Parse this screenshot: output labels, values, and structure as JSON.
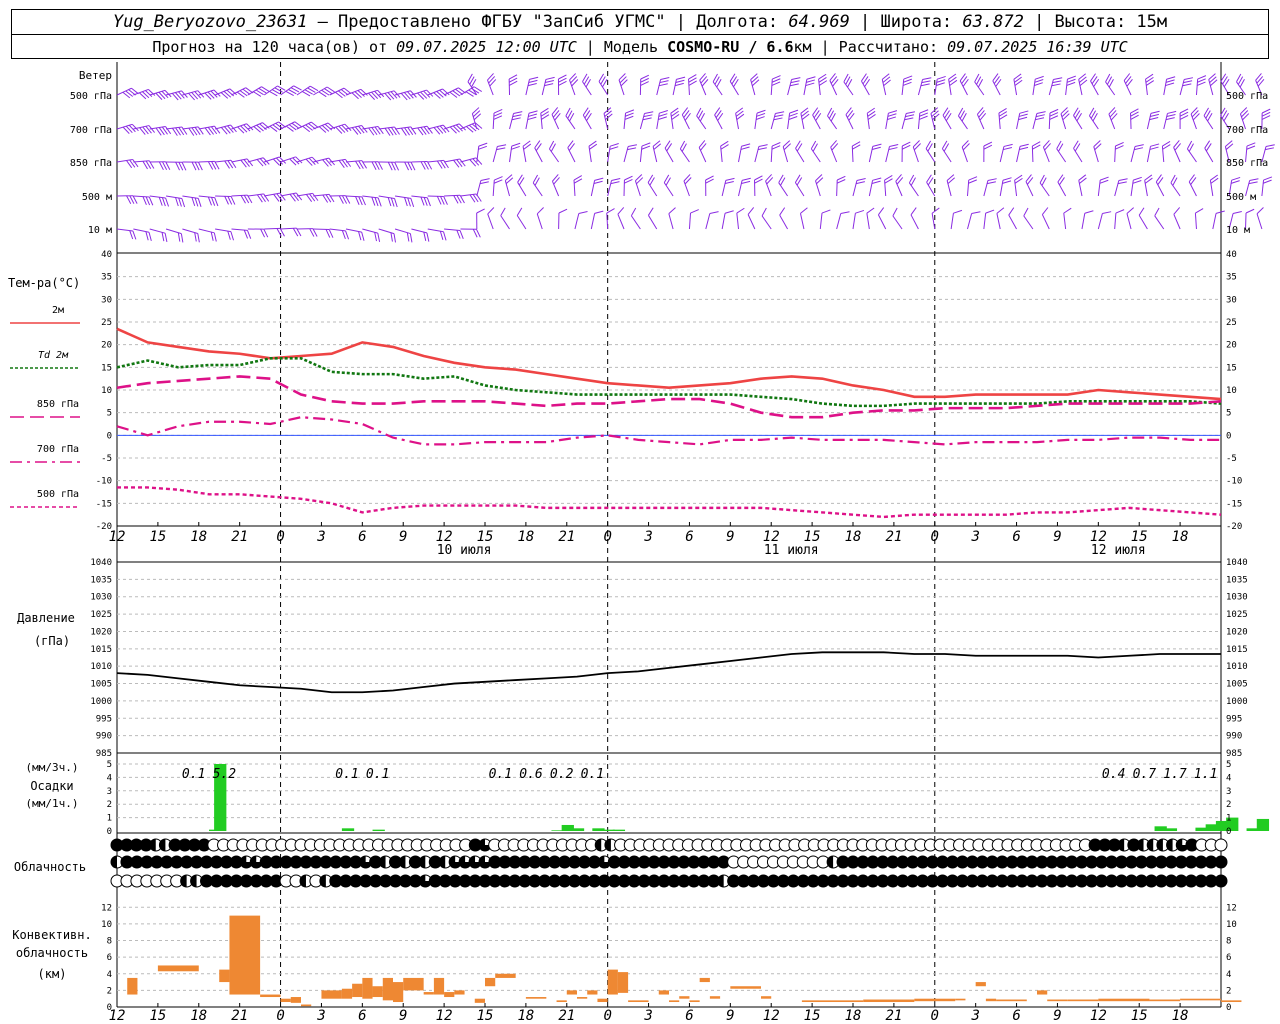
{
  "header": {
    "station": "Yug_Beryozovo_23631",
    "provider": " — Предоставлено ФГБУ \"ЗапСиб УГМС\" | ",
    "lon_label": "Долгота: ",
    "lon_value": "64.969",
    "lat_label": " | Широта: ",
    "lat_value": "63.872",
    "alt_label": " | Высота: ",
    "alt_value": "15м",
    "fc_label": "Прогноз на 120 часа(ов) от ",
    "fc_value": "09.07.2025 12:00 UTC",
    "model_label": " | Модель ",
    "model_value": "COSMO-RU / 6.6",
    "model_unit": "км",
    "calc_label": " | Рассчитано: ",
    "calc_value": "09.07.2025 16:39 UTC"
  },
  "chart_data": {
    "time": {
      "ticks": [
        "12",
        "15",
        "18",
        "21",
        "0",
        "3",
        "6",
        "9",
        "12",
        "15",
        "18",
        "21",
        "0",
        "3",
        "6",
        "9",
        "12",
        "15",
        "18",
        "21",
        "0",
        "3",
        "6",
        "9",
        "12",
        "15",
        "18"
      ],
      "days": [
        {
          "label": "10 июля",
          "at_tick": 8
        },
        {
          "label": "11 июля",
          "at_tick": 16
        },
        {
          "label": "12 июля",
          "at_tick": 24
        }
      ],
      "midnight_ticks": [
        4,
        12,
        20
      ]
    },
    "wind": {
      "title": "Ветер",
      "levels": [
        "500 гПа",
        "700 гПа",
        "850 гПа",
        "500 м",
        "10  м"
      ],
      "color": "#8a2be2"
    },
    "temperature": {
      "title": "Тем-ра(°C)",
      "ylim": [
        -20,
        40
      ],
      "ticks": [
        -20,
        -15,
        -10,
        -5,
        0,
        5,
        10,
        15,
        20,
        25,
        30,
        35,
        40
      ],
      "series": [
        {
          "name": "2м",
          "key": "t2m",
          "color": "#ee4444",
          "values": [
            23.5,
            20.5,
            19.5,
            18.5,
            18,
            17,
            17.5,
            18,
            20.5,
            19.5,
            17.5,
            16,
            15,
            14.5,
            13.5,
            12.5,
            11.5,
            11,
            10.5,
            11,
            11.5,
            12.5,
            13,
            12.5,
            11,
            10,
            8.5,
            8.5,
            9,
            9,
            9,
            9,
            10,
            9.5,
            9,
            8.5,
            8
          ]
        },
        {
          "name": "Td  2м",
          "key": "td2m",
          "color": "#117711",
          "values": [
            15,
            16.5,
            15,
            15.5,
            15.5,
            17,
            17,
            14,
            13.5,
            13.5,
            12.5,
            13,
            11,
            10,
            9.5,
            9,
            9,
            9,
            9,
            9,
            9,
            8.5,
            8,
            7,
            6.5,
            6.5,
            7,
            7,
            7,
            7,
            7,
            7.5,
            7.5,
            7.5,
            7.5,
            7.5,
            7
          ]
        },
        {
          "name": "850 гПа",
          "key": "t850",
          "color": "#dd1188",
          "values": [
            10.5,
            11.5,
            12,
            12.5,
            13,
            12.5,
            9,
            7.5,
            7,
            7,
            7.5,
            7.5,
            7.5,
            7,
            6.5,
            7,
            7,
            7.5,
            8,
            8,
            7,
            5,
            4,
            4,
            5,
            5.5,
            5.5,
            6,
            6,
            6,
            6.5,
            7,
            7,
            7,
            7,
            7,
            7.5
          ]
        },
        {
          "name": "700 гПа",
          "key": "t700",
          "color": "#dd1188",
          "values": [
            2,
            0,
            2,
            3,
            3,
            2.5,
            4,
            3.5,
            2.5,
            -0.5,
            -2,
            -2,
            -1.5,
            -1.5,
            -1.5,
            -0.5,
            0,
            -1,
            -1.5,
            -2,
            -1,
            -1,
            -0.5,
            -1,
            -1,
            -1,
            -1.5,
            -2,
            -1.5,
            -1.5,
            -1.5,
            -1,
            -1,
            -0.5,
            -0.5,
            -1,
            -1
          ]
        },
        {
          "name": "500 гПа",
          "key": "t500",
          "color": "#dd1188",
          "values": [
            -11.5,
            -11.5,
            -12,
            -13,
            -13,
            -13.5,
            -14,
            -15,
            -17,
            -16,
            -15.5,
            -15.5,
            -15.5,
            -15.5,
            -16,
            -16,
            -16,
            -16,
            -16,
            -16,
            -16,
            -16,
            -16.5,
            -17,
            -17.5,
            -18,
            -17.5,
            -17.5,
            -17.5,
            -17.5,
            -17,
            -17,
            -16.5,
            -16,
            -16.5,
            -17,
            -17.5
          ]
        }
      ]
    },
    "pressure": {
      "title": "Давление",
      "unit": "(гПа)",
      "ylim": [
        985,
        1040
      ],
      "ticks": [
        985,
        990,
        995,
        1000,
        1005,
        1010,
        1015,
        1020,
        1025,
        1030,
        1035,
        1040
      ],
      "color": "#000000",
      "values": [
        1008,
        1007.5,
        1006.5,
        1005.5,
        1004.5,
        1004,
        1003.5,
        1002.5,
        1002.5,
        1003,
        1004,
        1005,
        1005.5,
        1006,
        1006.5,
        1007,
        1008,
        1008.5,
        1009.5,
        1010.5,
        1011.5,
        1012.5,
        1013.5,
        1014,
        1014,
        1014,
        1013.5,
        1013.5,
        1013,
        1013,
        1013,
        1013,
        1012.5,
        1013,
        1013.5,
        1013.5,
        1013.5
      ]
    },
    "precipitation": {
      "title": "Осадки",
      "unit_3h": "(мм/3ч.)",
      "unit_1h": "(мм/1ч.)",
      "ylim": [
        0,
        5
      ],
      "ticks": [
        0,
        1,
        2,
        3,
        4,
        5
      ],
      "color": "#22cc22",
      "bars": [
        {
          "x": 9.5,
          "v": 0.1
        },
        {
          "x": 10,
          "v": 5.0
        },
        {
          "x": 22.5,
          "v": 0.2
        },
        {
          "x": 25.5,
          "v": 0.1
        },
        {
          "x": 43,
          "v": 0.05
        },
        {
          "x": 44,
          "v": 0.45
        },
        {
          "x": 45,
          "v": 0.2
        },
        {
          "x": 47,
          "v": 0.2
        },
        {
          "x": 48,
          "v": 0.1
        },
        {
          "x": 49,
          "v": 0.1
        },
        {
          "x": 102,
          "v": 0.35
        },
        {
          "x": 103,
          "v": 0.2
        },
        {
          "x": 106,
          "v": 0.25
        },
        {
          "x": 107,
          "v": 0.5
        },
        {
          "x": 108,
          "v": 0.75
        },
        {
          "x": 109,
          "v": 1.0
        },
        {
          "x": 111,
          "v": 0.2
        },
        {
          "x": 112,
          "v": 0.9
        }
      ],
      "labels_3h": [
        {
          "x": 7.5,
          "text": "0.1"
        },
        {
          "x": 10.5,
          "text": "5.2"
        },
        {
          "x": 22.5,
          "text": "0.1"
        },
        {
          "x": 25.5,
          "text": "0.1"
        },
        {
          "x": 37.5,
          "text": "0.1"
        },
        {
          "x": 40.5,
          "text": "0.6"
        },
        {
          "x": 43.5,
          "text": "0.2"
        },
        {
          "x": 46.5,
          "text": "0.1"
        },
        {
          "x": 97.5,
          "text": "0.4"
        },
        {
          "x": 100.5,
          "text": "0.7"
        },
        {
          "x": 103.5,
          "text": "1.7"
        },
        {
          "x": 106.5,
          "text": "1.1"
        }
      ]
    },
    "clouds": {
      "title": "Облачность",
      "rows": [
        "FFFFHHFFFF000000000000000000000000000FQ00000000000HH0000000000000000000000000000000000000000000000000FFFHFHHHHQF000",
        "HFFFFFFFFFFFFQQFFFFFFFFFFQFHFHFHFHQQQQFFFFFFFFFFFQFFFFFFFFFFFF0000000000HFFFFFFFFFFFFFFFFFFFFFFFFFFFFFFFFFFFFFFF",
        "0000000HHFFFFFFFF00H0HFFFFFFFFFQFFFFFFFFFFFFFFFFFFFFFFFFFFFFFHFFFFFFFFFFFFFFFFFFFFFFFFFFFFFFFFFFFFFFFFFFFFFFFFFF"
      ]
    },
    "convective": {
      "title_1": "Конвективн.",
      "title_2": "облачность",
      "unit": "(км)",
      "ylim": [
        0,
        13
      ],
      "ticks": [
        0,
        2,
        4,
        6,
        8,
        10,
        12
      ],
      "color": "#ee8833",
      "bars": [
        {
          "x0": 1,
          "x1": 2,
          "b": 1.5,
          "t": 3.5
        },
        {
          "x0": 4,
          "x1": 8,
          "b": 4.3,
          "t": 5.0
        },
        {
          "x0": 10,
          "x1": 11,
          "b": 3.0,
          "t": 4.5
        },
        {
          "x0": 11,
          "x1": 14,
          "b": 1.5,
          "t": 11.0
        },
        {
          "x0": 14,
          "x1": 16,
          "b": 1.2,
          "t": 1.5
        },
        {
          "x0": 16,
          "x1": 17,
          "b": 0.6,
          "t": 1.0
        },
        {
          "x0": 17,
          "x1": 18,
          "b": 0.5,
          "t": 1.2
        },
        {
          "x0": 18,
          "x1": 19,
          "b": 0.1,
          "t": 0.3
        },
        {
          "x0": 20,
          "x1": 22,
          "b": 1.0,
          "t": 2.0
        },
        {
          "x0": 22,
          "x1": 23,
          "b": 1.0,
          "t": 2.2
        },
        {
          "x0": 23,
          "x1": 24,
          "b": 1.2,
          "t": 2.8
        },
        {
          "x0": 24,
          "x1": 25,
          "b": 1.0,
          "t": 3.5
        },
        {
          "x0": 25,
          "x1": 26,
          "b": 1.2,
          "t": 2.5
        },
        {
          "x0": 26,
          "x1": 27,
          "b": 0.8,
          "t": 3.5
        },
        {
          "x0": 27,
          "x1": 28,
          "b": 0.6,
          "t": 3.0
        },
        {
          "x0": 28,
          "x1": 30,
          "b": 2.0,
          "t": 3.5
        },
        {
          "x0": 30,
          "x1": 31,
          "b": 1.5,
          "t": 1.8
        },
        {
          "x0": 31,
          "x1": 32,
          "b": 1.5,
          "t": 3.5
        },
        {
          "x0": 32,
          "x1": 33,
          "b": 1.2,
          "t": 1.8
        },
        {
          "x0": 33,
          "x1": 34,
          "b": 1.5,
          "t": 2.0
        },
        {
          "x0": 35,
          "x1": 36,
          "b": 0.5,
          "t": 1.0
        },
        {
          "x0": 36,
          "x1": 37,
          "b": 2.5,
          "t": 3.5
        },
        {
          "x0": 37,
          "x1": 39,
          "b": 3.5,
          "t": 4.0
        },
        {
          "x0": 40,
          "x1": 42,
          "b": 1.0,
          "t": 1.2
        },
        {
          "x0": 43,
          "x1": 44,
          "b": 0.6,
          "t": 0.8
        },
        {
          "x0": 44,
          "x1": 45,
          "b": 1.5,
          "t": 2.0
        },
        {
          "x0": 45,
          "x1": 46,
          "b": 1.0,
          "t": 1.2
        },
        {
          "x0": 46,
          "x1": 47,
          "b": 1.5,
          "t": 2.0
        },
        {
          "x0": 47,
          "x1": 48,
          "b": 0.6,
          "t": 1.0
        },
        {
          "x0": 48,
          "x1": 49,
          "b": 1.5,
          "t": 4.5
        },
        {
          "x0": 49,
          "x1": 50,
          "b": 1.7,
          "t": 4.2
        },
        {
          "x0": 50,
          "x1": 52,
          "b": 0.6,
          "t": 0.8
        },
        {
          "x0": 53,
          "x1": 54,
          "b": 1.5,
          "t": 2.0
        },
        {
          "x0": 54,
          "x1": 55,
          "b": 0.6,
          "t": 0.8
        },
        {
          "x0": 55,
          "x1": 56,
          "b": 1.0,
          "t": 1.3
        },
        {
          "x0": 56,
          "x1": 57,
          "b": 0.6,
          "t": 0.8
        },
        {
          "x0": 57,
          "x1": 58,
          "b": 3.0,
          "t": 3.5
        },
        {
          "x0": 58,
          "x1": 59,
          "b": 1.0,
          "t": 1.3
        },
        {
          "x0": 60,
          "x1": 63,
          "b": 2.2,
          "t": 2.5
        },
        {
          "x0": 63,
          "x1": 64,
          "b": 1.0,
          "t": 1.3
        },
        {
          "x0": 67,
          "x1": 73,
          "b": 0.6,
          "t": 0.8
        },
        {
          "x0": 73,
          "x1": 78,
          "b": 0.6,
          "t": 0.9
        },
        {
          "x0": 78,
          "x1": 82,
          "b": 0.7,
          "t": 1.0
        },
        {
          "x0": 82,
          "x1": 83,
          "b": 0.8,
          "t": 1.0
        },
        {
          "x0": 84,
          "x1": 85,
          "b": 2.5,
          "t": 3.0
        },
        {
          "x0": 85,
          "x1": 86,
          "b": 0.7,
          "t": 1.0
        },
        {
          "x0": 86,
          "x1": 89,
          "b": 0.7,
          "t": 0.9
        },
        {
          "x0": 90,
          "x1": 91,
          "b": 1.5,
          "t": 2.0
        },
        {
          "x0": 91,
          "x1": 93,
          "b": 0.7,
          "t": 0.9
        },
        {
          "x0": 93,
          "x1": 96,
          "b": 0.7,
          "t": 0.9
        },
        {
          "x0": 96,
          "x1": 101,
          "b": 0.7,
          "t": 1.0
        },
        {
          "x0": 101,
          "x1": 104,
          "b": 0.7,
          "t": 0.9
        },
        {
          "x0": 104,
          "x1": 108,
          "b": 0.8,
          "t": 1.0
        },
        {
          "x0": 108,
          "x1": 110,
          "b": 0.6,
          "t": 0.8
        }
      ]
    }
  }
}
